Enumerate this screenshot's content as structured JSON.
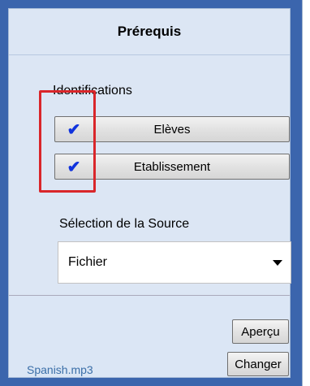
{
  "header": {
    "title": "Prérequis"
  },
  "identifications": {
    "label": "Identifications",
    "items": [
      {
        "label": "Elèves",
        "checked": true,
        "check_glyph": "✔"
      },
      {
        "label": "Etablissement",
        "checked": true,
        "check_glyph": "✔"
      }
    ]
  },
  "source": {
    "label": "Sélection de la Source",
    "selected": "Fichier"
  },
  "footer": {
    "filename": "Spanish.mp3",
    "apercu_label": "Aperçu",
    "changer_label": "Changer"
  },
  "colors": {
    "panel_border": "#3b65ad",
    "panel_bg": "#dce6f4",
    "check": "#1133dd",
    "highlight": "#d9262a",
    "filename": "#3b6fa8"
  }
}
